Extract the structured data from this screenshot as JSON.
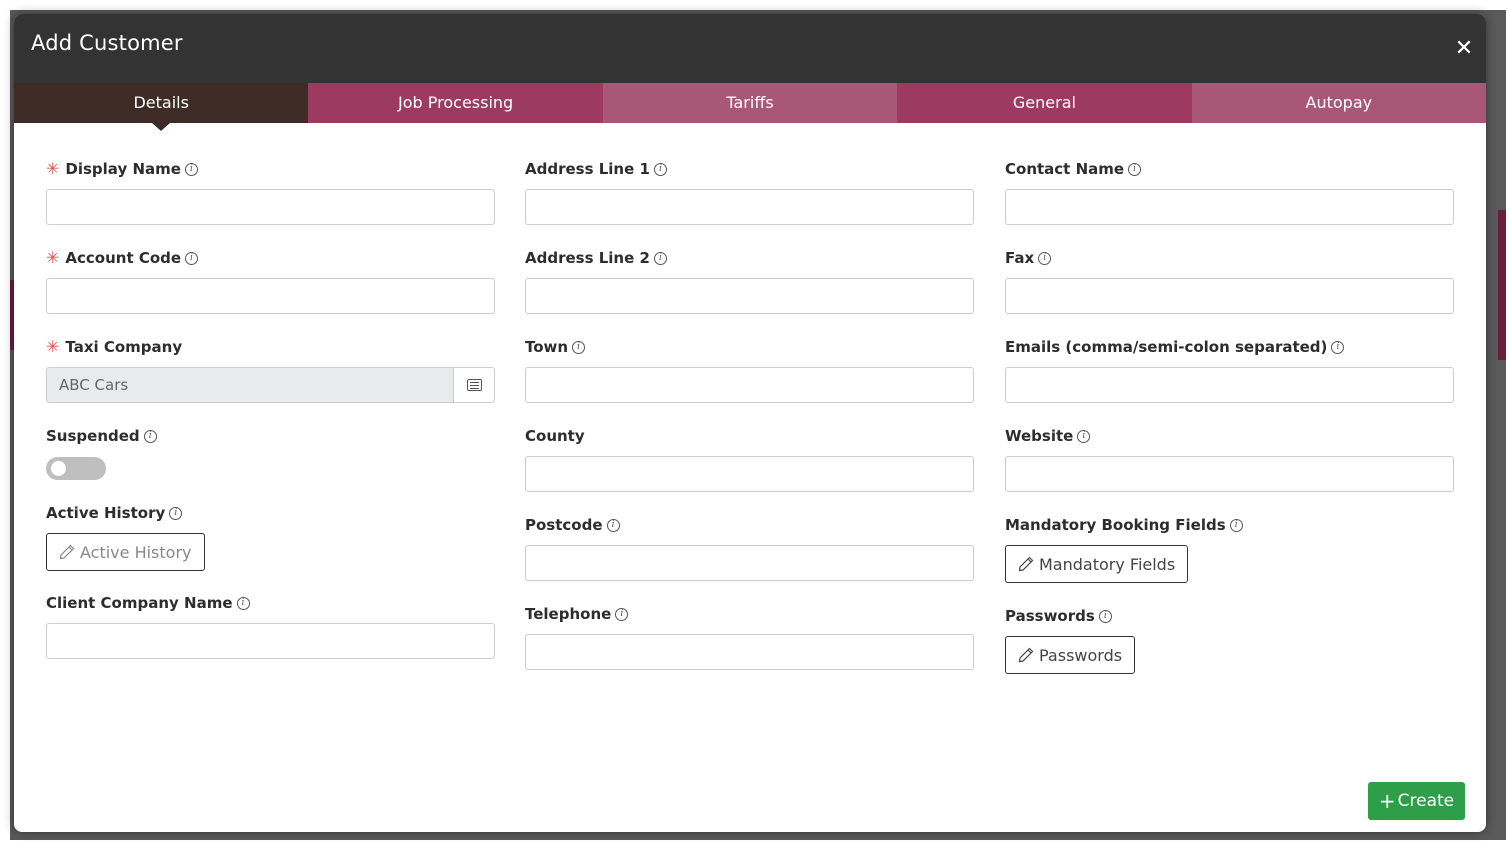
{
  "modal": {
    "title": "Add Customer"
  },
  "tabs": [
    {
      "label": "Details",
      "color": "#3e2b26"
    },
    {
      "label": "Job Processing",
      "color": "#9c3a62"
    },
    {
      "label": "Tariffs",
      "color": "#a95776"
    },
    {
      "label": "General",
      "color": "#9c3a62"
    },
    {
      "label": "Autopay",
      "color": "#a95776"
    }
  ],
  "colors": {
    "header": "#333333",
    "accent_required": "#d9534f",
    "create": "#2e9e48"
  },
  "col1": {
    "display_name": {
      "label": "Display Name",
      "value": ""
    },
    "account_code": {
      "label": "Account Code",
      "value": ""
    },
    "taxi_company": {
      "label": "Taxi Company",
      "value": "ABC Cars"
    },
    "suspended": {
      "label": "Suspended",
      "state": "off"
    },
    "active_history": {
      "label": "Active History",
      "button": "Active History"
    },
    "client_company_name": {
      "label": "Client Company Name",
      "value": ""
    }
  },
  "col2": {
    "address_line_1": {
      "label": "Address Line 1",
      "value": ""
    },
    "address_line_2": {
      "label": "Address Line 2",
      "value": ""
    },
    "town": {
      "label": "Town",
      "value": ""
    },
    "county": {
      "label": "County",
      "value": ""
    },
    "postcode": {
      "label": "Postcode",
      "value": ""
    },
    "telephone": {
      "label": "Telephone",
      "value": ""
    }
  },
  "col3": {
    "contact_name": {
      "label": "Contact Name",
      "value": ""
    },
    "fax": {
      "label": "Fax",
      "value": ""
    },
    "emails": {
      "label": "Emails (comma/semi-colon separated)",
      "value": ""
    },
    "website": {
      "label": "Website",
      "value": ""
    },
    "mandatory_booking_fields": {
      "label": "Mandatory Booking Fields",
      "button": "Mandatory Fields"
    },
    "passwords": {
      "label": "Passwords",
      "button": "Passwords"
    }
  },
  "footer": {
    "create_label": "Create"
  }
}
